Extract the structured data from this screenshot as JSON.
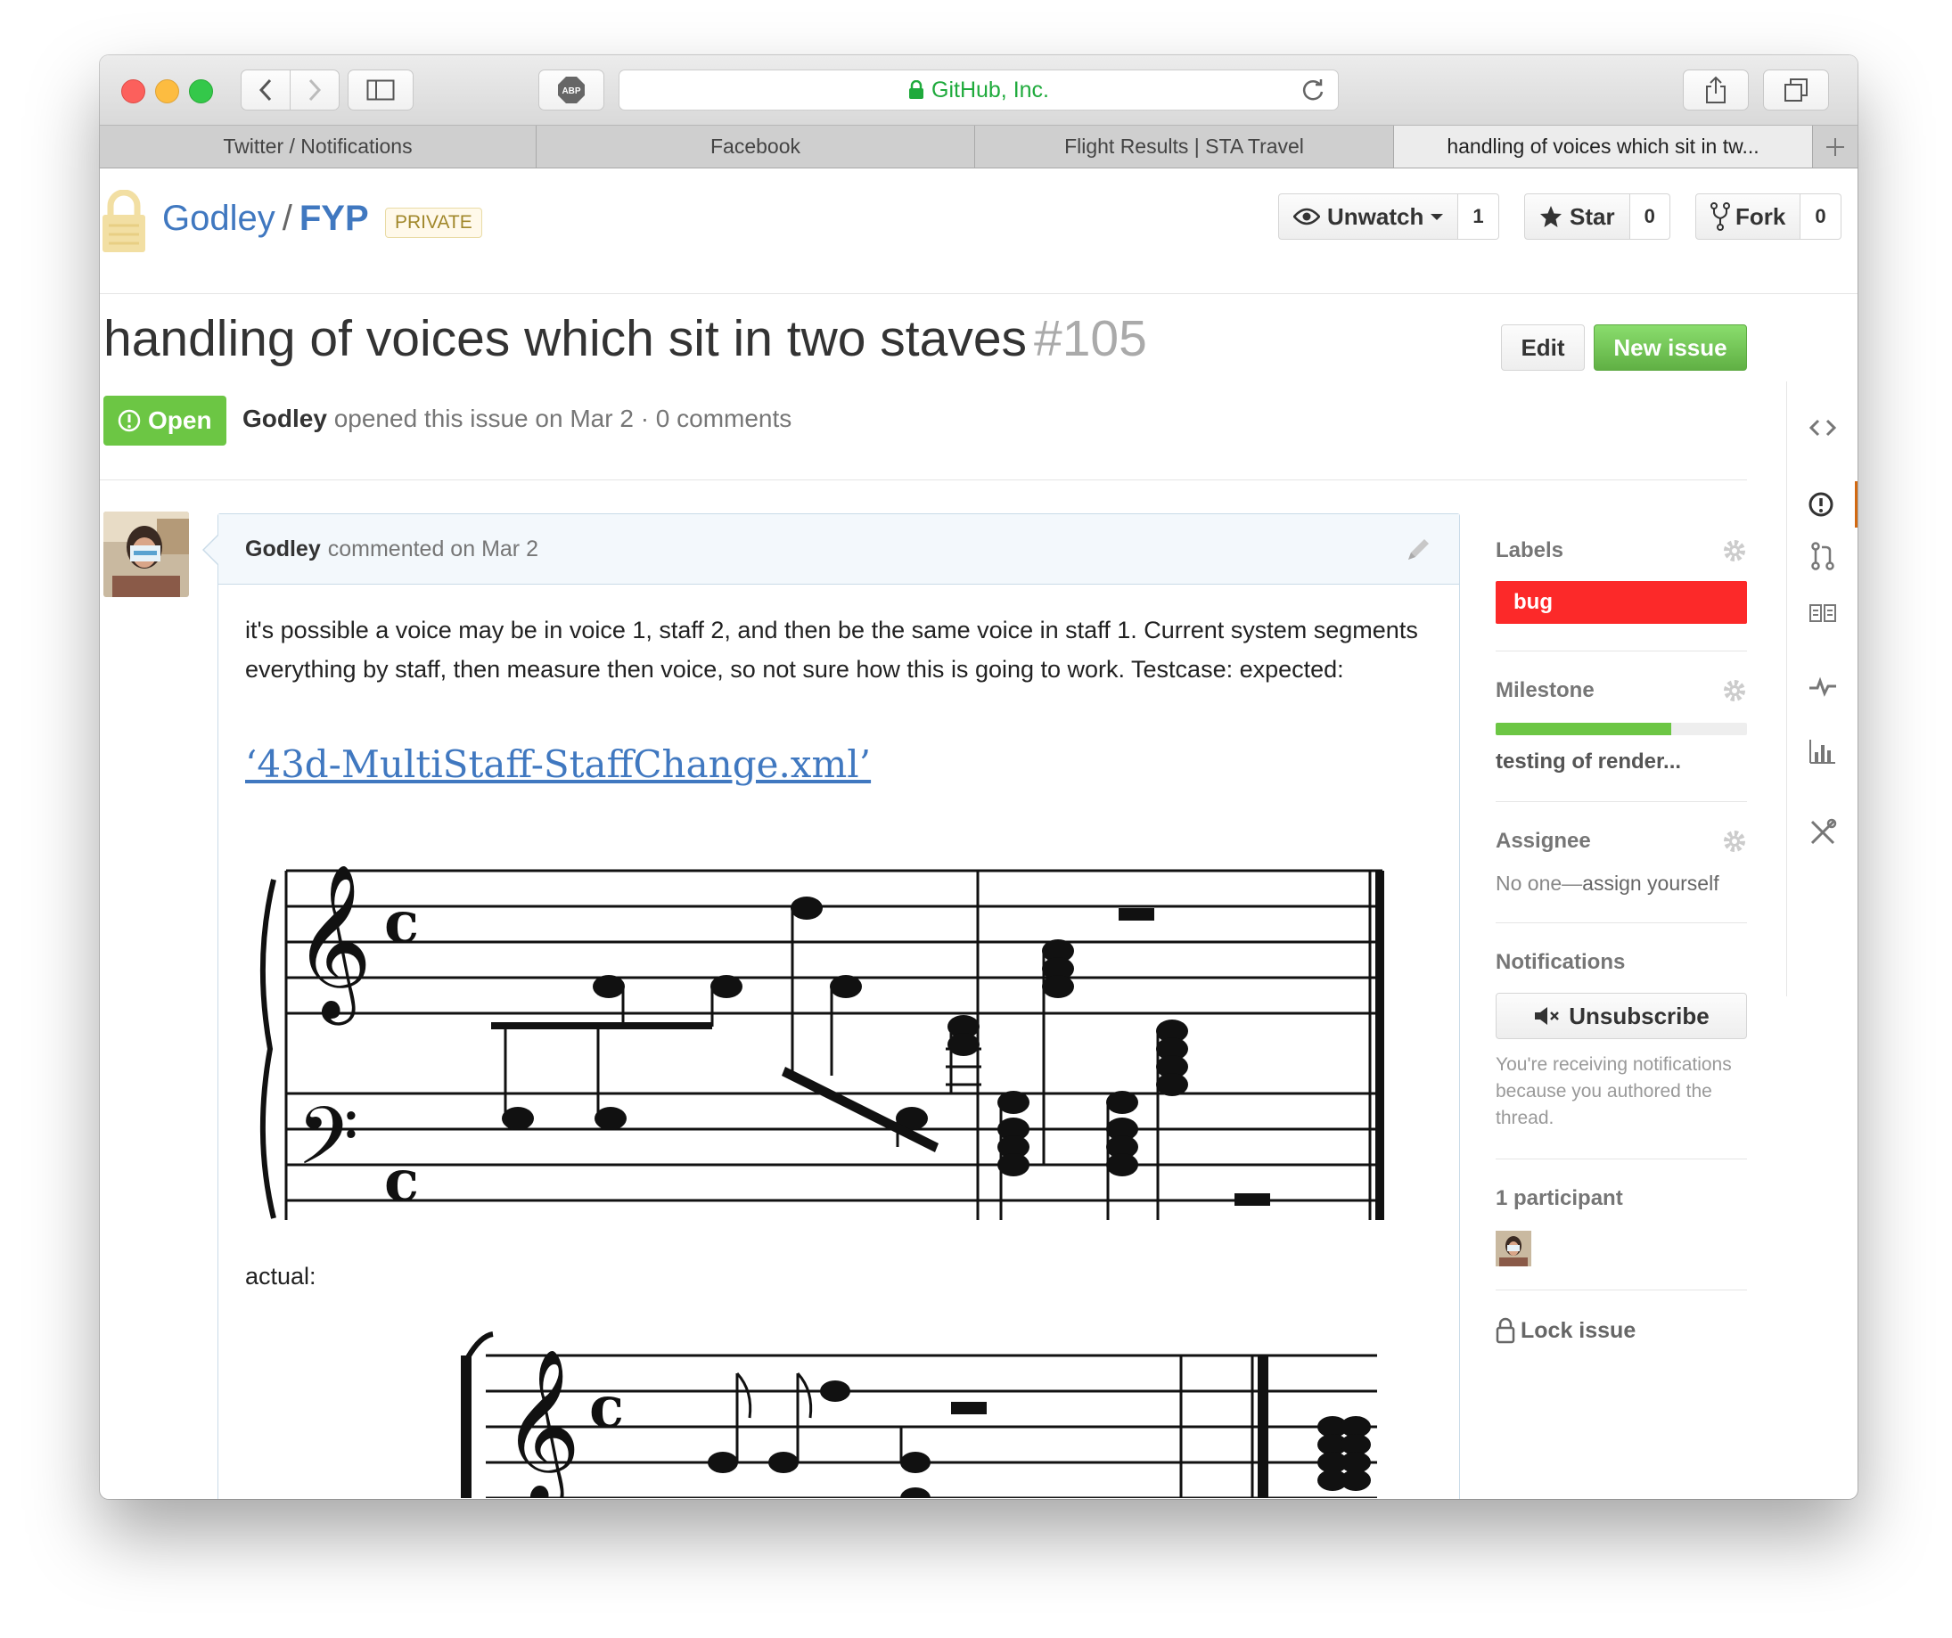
{
  "browser": {
    "address": "GitHub, Inc.",
    "adblock_label": "ABP",
    "tabs": [
      {
        "label": "Twitter / Notifications"
      },
      {
        "label": "Facebook"
      },
      {
        "label": "Flight Results | STA Travel"
      },
      {
        "label": "handling of voices which sit in tw..."
      }
    ]
  },
  "repo": {
    "owner": "Godley",
    "separator": "/",
    "name": "FYP",
    "visibility": "PRIVATE",
    "unwatch_label": "Unwatch",
    "unwatch_count": "1",
    "star_label": "Star",
    "star_count": "0",
    "fork_label": "Fork",
    "fork_count": "0"
  },
  "issue": {
    "title": "handling of voices which sit in two staves",
    "number": "#105",
    "edit_label": "Edit",
    "new_issue_label": "New issue",
    "state": "Open",
    "author": "Godley",
    "opened_text": "opened this issue on Mar 2 · 0 comments"
  },
  "comment": {
    "author": "Godley",
    "header_text": "commented on Mar 2",
    "body": "it's possible a voice may be in voice 1, staff 2, and then be the same voice in staff 1. Current system segments everything by staff, then measure then voice, so not sure how this is going to work. Testcase: expected:",
    "link_text": "‘43d-MultiStaff-StaffChange.xml’",
    "actual_label": "actual:"
  },
  "sidebar": {
    "labels_heading": "Labels",
    "label_bug": "bug",
    "milestone_heading": "Milestone",
    "milestone_progress": 0.7,
    "milestone_title": "testing of render...",
    "assignee_heading": "Assignee",
    "assignee_prefix": "No one—",
    "assignee_link": "assign yourself",
    "notifications_heading": "Notifications",
    "unsubscribe_label": "Unsubscribe",
    "notifications_text": "You're receiving notifications because you authored the thread.",
    "participants_heading": "1 participant",
    "lock_label": "Lock issue"
  },
  "colors": {
    "accent_link": "#4078c0",
    "open_green": "#6cc644",
    "bug_red": "#fc2929",
    "address_green": "#1faa3c"
  },
  "icons": {
    "right_nav": [
      "code-icon",
      "issue-opened-icon",
      "pull-request-icon",
      "wiki-book-icon",
      "pulse-icon",
      "graph-icon",
      "settings-tools-icon"
    ]
  }
}
